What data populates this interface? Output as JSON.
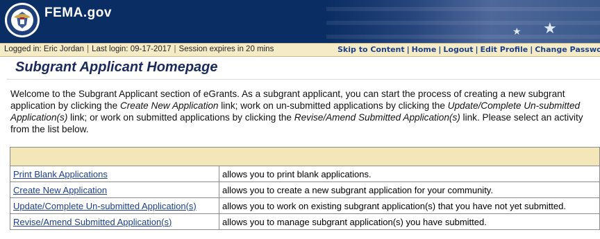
{
  "header": {
    "site_title": "FEMA.gov",
    "seal_icon": "dhs-seal-icon",
    "brand_color": "#0a2d63"
  },
  "session_bar": {
    "logged_in": "Logged in: Eric Jordan",
    "last_login": "Last login: 09-17-2017",
    "session_expires": "Session expires in 20 mins",
    "links": {
      "skip_to_content": "Skip to Content",
      "home": "Home",
      "logout": "Logout",
      "edit_profile": "Edit Profile",
      "change_password": "Change Passwor"
    }
  },
  "page": {
    "title": "Subgrant Applicant Homepage",
    "intro": {
      "p1": "Welcome to the Subgrant Applicant section of eGrants. As a subgrant applicant, you can start the process of creating a new subgrant application by clicking the ",
      "em1": "Create New Application",
      "p2": " link; work on un-submitted applications by clicking the ",
      "em2": "Update/Complete Un-submitted Application(s)",
      "p3": " link; or work on submitted applications by clicking the ",
      "em3": "Revise/Amend Submitted Application(s)",
      "p4": " link. Please select an activity from the list below."
    }
  },
  "activities": [
    {
      "link": "Print Blank Applications",
      "desc": "allows you to print blank applications."
    },
    {
      "link": "Create New Application",
      "desc": "allows you to create a new subgrant application for your community."
    },
    {
      "link": "Update/Complete Un-submitted Application(s)",
      "desc": "allows you to work on existing subgrant application(s) that you have not yet submitted."
    },
    {
      "link": "Revise/Amend Submitted Application(s)",
      "desc": "allows you to manage subgrant application(s) you have submitted."
    }
  ]
}
